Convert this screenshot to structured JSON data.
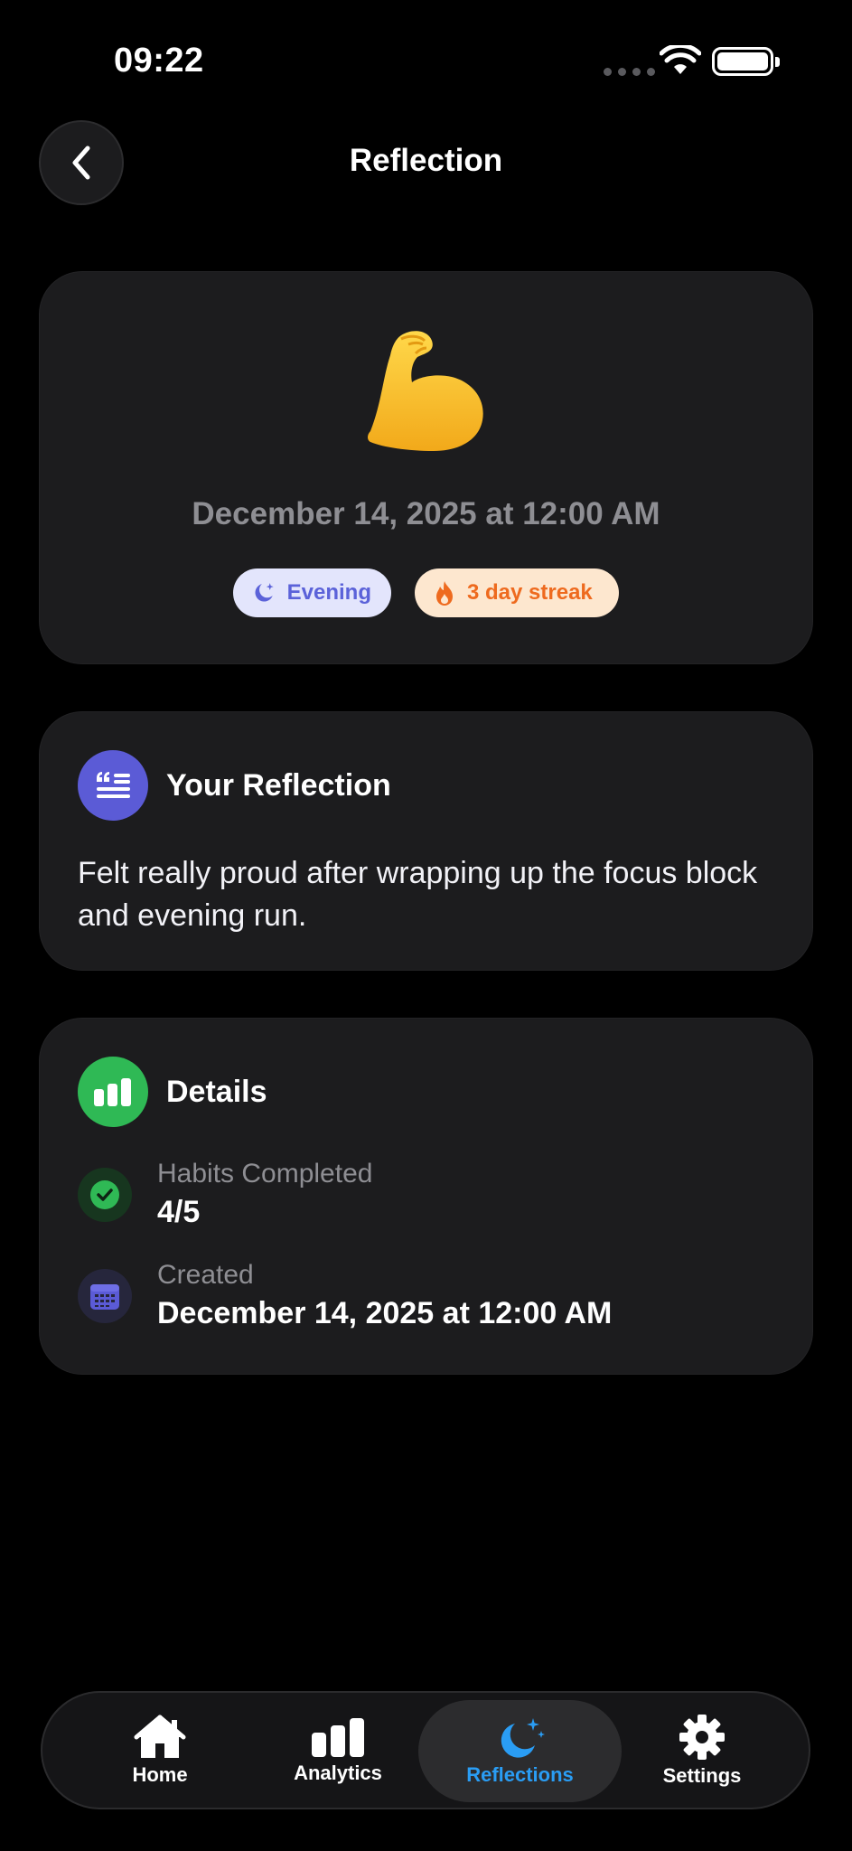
{
  "status_bar": {
    "time": "09:22"
  },
  "nav": {
    "title": "Reflection"
  },
  "hero": {
    "emoji": "💪",
    "date": "December 14, 2025 at 12:00 AM",
    "pills": {
      "evening": "Evening",
      "streak": "3 day streak"
    }
  },
  "reflection": {
    "title": "Your Reflection",
    "text": "Felt really proud after wrapping up the focus block and evening run."
  },
  "details": {
    "title": "Details",
    "habits_label": "Habits Completed",
    "habits_value": "4/5",
    "created_label": "Created",
    "created_value": "December 14, 2025 at 12:00 AM"
  },
  "tabs": {
    "home": "Home",
    "analytics": "Analytics",
    "reflections": "Reflections",
    "settings": "Settings",
    "active": "reflections"
  },
  "colors": {
    "background": "#000000",
    "card": "#1c1c1e",
    "accent_indigo": "#5b5bd6",
    "accent_green": "#2fb955",
    "accent_blue": "#2a9df4",
    "streak_orange": "#ee6a1e"
  },
  "icons": {
    "back": "chevron-left-icon",
    "evening": "moon-sparkle-icon",
    "streak": "flame-icon",
    "reflection": "quote-text-icon",
    "details": "bar-chart-icon",
    "habits": "check-circle-icon",
    "created": "calendar-icon"
  }
}
